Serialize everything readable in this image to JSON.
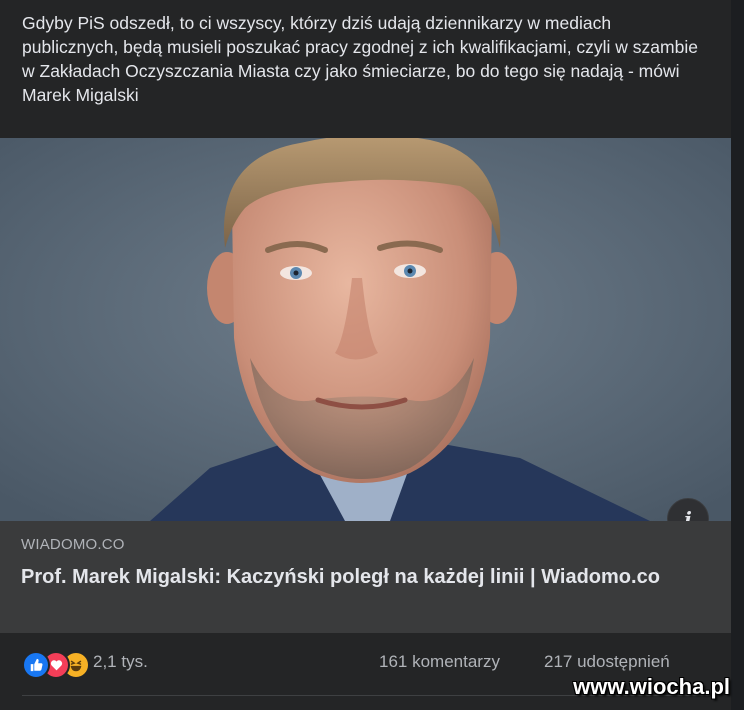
{
  "post": {
    "caption": "Gdyby PiS odszedł, to ci wszyscy, którzy dziś udają dziennikarzy w mediach publicznych, będą musieli poszukać pracy zgodnej z ich kwalifikacjami, czyli w szambie w Zakładach Oczyszczania Miasta czy jako śmieciarze, bo do tego się nadają - mówi Marek Migalski"
  },
  "link_preview": {
    "image": "portrait-photo",
    "info_icon": "info-icon",
    "domain": "WIADOMO.CO",
    "title": "Prof. Marek Migalski: Kaczyński poległ na każdej linii | Wiadomo.co"
  },
  "stats": {
    "reaction_icons": [
      "like-icon",
      "love-icon",
      "haha-icon"
    ],
    "reaction_count": "2,1 tys.",
    "comments": "161 komentarzy",
    "shares": "217 udostępnień"
  },
  "watermark": "www.wiocha.pl",
  "colors": {
    "background": "#242526",
    "link_box": "#3a3b3c",
    "text_primary": "#e4e6eb",
    "text_secondary": "#b0b3b8",
    "like": "#1877f2",
    "love": "#f33e58",
    "haha": "#f7b125"
  }
}
